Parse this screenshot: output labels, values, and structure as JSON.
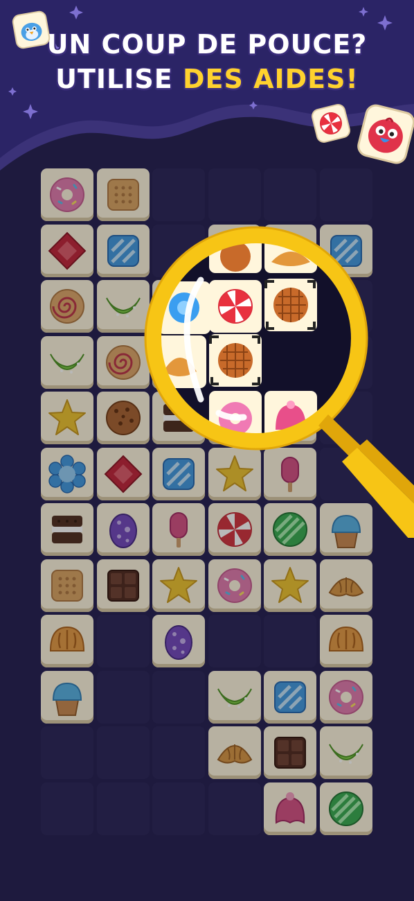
{
  "header": {
    "line1": "UN COUP DE POUCE?",
    "line2_prefix": "UTILISE",
    "line2_highlight": "DES AIDES!"
  },
  "colors": {
    "background": "#1e1a3e",
    "banner": "#3b3278",
    "title_text": "#ffffff",
    "title_highlight": "#ffd22e",
    "magnifier": "#f7c515",
    "tile_face": "#fff6dc"
  },
  "board": {
    "columns": 6,
    "rows": 12,
    "tiles": [
      {
        "row": 0,
        "col": 0,
        "item": "donut",
        "state": "free"
      },
      {
        "row": 0,
        "col": 1,
        "item": "cracker",
        "state": "free"
      },
      {
        "row": 1,
        "col": 0,
        "item": "red-jelly",
        "state": "free"
      },
      {
        "row": 1,
        "col": 1,
        "item": "blue-candy",
        "state": "free"
      },
      {
        "row": 1,
        "col": 3,
        "item": "waffle",
        "state": "free"
      },
      {
        "row": 1,
        "col": 4,
        "item": "croissant",
        "state": "free"
      },
      {
        "row": 1,
        "col": 5,
        "item": "blue-candy",
        "state": "free"
      },
      {
        "row": 2,
        "col": 0,
        "item": "swirl-roll",
        "state": "free"
      },
      {
        "row": 2,
        "col": 1,
        "item": "lime-gummy",
        "state": "free"
      },
      {
        "row": 2,
        "col": 2,
        "item": "blue-flower",
        "state": "free"
      },
      {
        "row": 2,
        "col": 3,
        "item": "peppermint",
        "state": "free"
      },
      {
        "row": 2,
        "col": 4,
        "item": "waffle",
        "state": "hint"
      },
      {
        "row": 3,
        "col": 0,
        "item": "lime-gummy",
        "state": "free"
      },
      {
        "row": 3,
        "col": 1,
        "item": "swirl-roll",
        "state": "free"
      },
      {
        "row": 3,
        "col": 2,
        "item": "croissant",
        "state": "free"
      },
      {
        "row": 3,
        "col": 3,
        "item": "waffle",
        "state": "hint"
      },
      {
        "row": 4,
        "col": 0,
        "item": "star",
        "state": "free"
      },
      {
        "row": 4,
        "col": 1,
        "item": "cookie",
        "state": "free"
      },
      {
        "row": 4,
        "col": 2,
        "item": "sandwich-cookie",
        "state": "free"
      },
      {
        "row": 4,
        "col": 3,
        "item": "donut",
        "state": "free"
      },
      {
        "row": 4,
        "col": 4,
        "item": "pink-jelly",
        "state": "free"
      },
      {
        "row": 5,
        "col": 0,
        "item": "blue-flower",
        "state": "free"
      },
      {
        "row": 5,
        "col": 1,
        "item": "red-jelly",
        "state": "free"
      },
      {
        "row": 5,
        "col": 2,
        "item": "blue-candy",
        "state": "free"
      },
      {
        "row": 5,
        "col": 3,
        "item": "star",
        "state": "free"
      },
      {
        "row": 5,
        "col": 4,
        "item": "popsicle",
        "state": "free"
      },
      {
        "row": 6,
        "col": 0,
        "item": "sandwich-cookie",
        "state": "free"
      },
      {
        "row": 6,
        "col": 1,
        "item": "egg",
        "state": "free"
      },
      {
        "row": 6,
        "col": 2,
        "item": "popsicle",
        "state": "free"
      },
      {
        "row": 6,
        "col": 3,
        "item": "peppermint",
        "state": "free"
      },
      {
        "row": 6,
        "col": 4,
        "item": "green-candy",
        "state": "free"
      },
      {
        "row": 6,
        "col": 5,
        "item": "cupcake",
        "state": "free"
      },
      {
        "row": 7,
        "col": 0,
        "item": "cracker",
        "state": "free"
      },
      {
        "row": 7,
        "col": 1,
        "item": "chocolate",
        "state": "free"
      },
      {
        "row": 7,
        "col": 2,
        "item": "star",
        "state": "free"
      },
      {
        "row": 7,
        "col": 3,
        "item": "donut",
        "state": "free"
      },
      {
        "row": 7,
        "col": 4,
        "item": "star",
        "state": "free"
      },
      {
        "row": 7,
        "col": 5,
        "item": "croissant",
        "state": "free"
      },
      {
        "row": 8,
        "col": 0,
        "item": "bun",
        "state": "free"
      },
      {
        "row": 8,
        "col": 2,
        "item": "egg",
        "state": "free"
      },
      {
        "row": 8,
        "col": 5,
        "item": "bun",
        "state": "free"
      },
      {
        "row": 9,
        "col": 0,
        "item": "cupcake",
        "state": "free"
      },
      {
        "row": 9,
        "col": 3,
        "item": "lime-gummy",
        "state": "free"
      },
      {
        "row": 9,
        "col": 4,
        "item": "blue-candy",
        "state": "free"
      },
      {
        "row": 9,
        "col": 5,
        "item": "donut",
        "state": "free"
      },
      {
        "row": 10,
        "col": 3,
        "item": "croissant",
        "state": "free"
      },
      {
        "row": 10,
        "col": 4,
        "item": "chocolate",
        "state": "free"
      },
      {
        "row": 10,
        "col": 5,
        "item": "lime-gummy",
        "state": "free"
      },
      {
        "row": 11,
        "col": 4,
        "item": "pink-jelly",
        "state": "free"
      },
      {
        "row": 11,
        "col": 5,
        "item": "green-candy",
        "state": "free"
      }
    ]
  },
  "decorations": {
    "mascot_left": "blue-bird-mascot-icon",
    "mascot_right": "red-bird-mascot-icon",
    "candy_tile": "peppermint-icon",
    "tool": "magnifier-hint-icon"
  }
}
